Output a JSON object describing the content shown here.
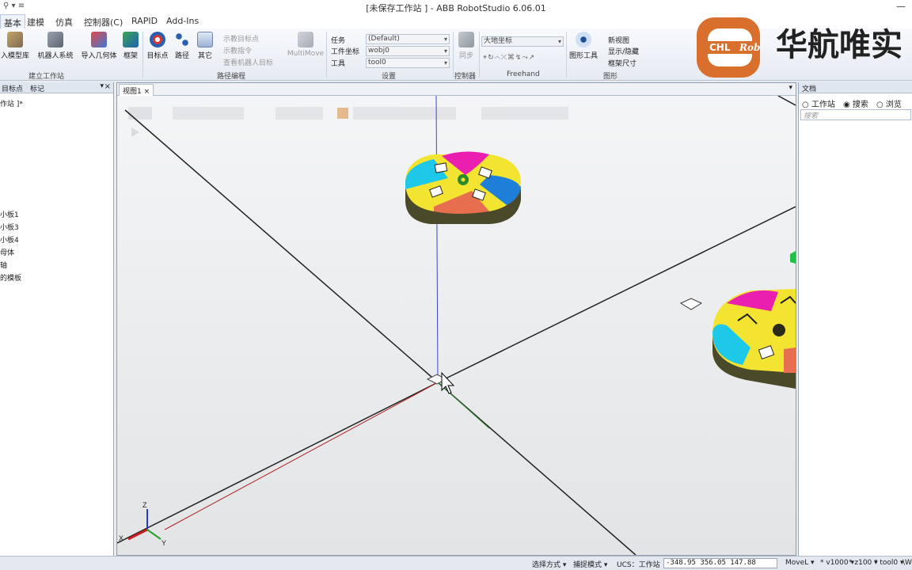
{
  "window": {
    "title": "[未保存工作站 ] - ABB RobotStudio 6.06.01",
    "quick_access": "⚲ ▾ ≡",
    "controls": "—"
  },
  "tabs": [
    {
      "label": "基本"
    },
    {
      "label": "建模"
    },
    {
      "label": "仿真"
    },
    {
      "label": "控制器(C)"
    },
    {
      "label": "RAPID"
    },
    {
      "label": "Add-Ins"
    }
  ],
  "ribbon": {
    "build": {
      "import_library": "入模型库",
      "robot_system": "机器人系统",
      "import_geometry": "导入几何体",
      "frame": "框架",
      "group": "建立工作站"
    },
    "path": {
      "target": "目标点",
      "path": "路径",
      "other": "其它",
      "teach_target": "示教目标点",
      "teach_instruction": "示教指令",
      "view_robot_target": "查看机器人目标",
      "multimove": "MultiMove",
      "group": "路径编程"
    },
    "settings": {
      "task_label": "任务",
      "task_value": "(Default)",
      "wobj_label": "工件坐标",
      "wobj_value": "wobj0",
      "tool_label": "工具",
      "tool_value": "tool0",
      "group": "设置"
    },
    "controller": {
      "sync": "同步",
      "group": "控制器"
    },
    "freehand": {
      "frame_value": "大地坐标",
      "group": "Freehand"
    },
    "graphics": {
      "graphic_tools": "图形工具",
      "new_view": "新视图",
      "show_hide": "显示/隐藏",
      "frame_size": "框架尺寸",
      "group": "图形"
    },
    "logo": {
      "chl": "CHL",
      "rob": "Rob",
      "text": "华航唯实"
    }
  },
  "left_panel": {
    "tabs": [
      "目标点",
      "标记"
    ],
    "items": [
      "作站 ]*",
      "小板1",
      "小板3",
      "小板4",
      "母体",
      "轴",
      "的模板"
    ]
  },
  "viewport": {
    "tab_label": "视图1",
    "axes": {
      "x": "X",
      "y": "Y",
      "z": "Z"
    }
  },
  "right_panel": {
    "title": "文档",
    "radio_station": "工作站",
    "radio_search": "搜索",
    "radio_browse": "浏览",
    "search_placeholder": "搜索"
  },
  "status": {
    "select_mode": "选择方式",
    "snap_mode": "捕捉模式",
    "ucs": "UCS：工作站",
    "coords": "-348.95  356.05  147.88",
    "move_instr": "MoveL",
    "speed": "v1000",
    "zone": "z100",
    "tool": "tool0",
    "extra": "\\W"
  },
  "colors": {
    "accent": "#d96f2c",
    "ribbon_border": "#b7c3d3",
    "viewport_bg": "#ffffff"
  }
}
